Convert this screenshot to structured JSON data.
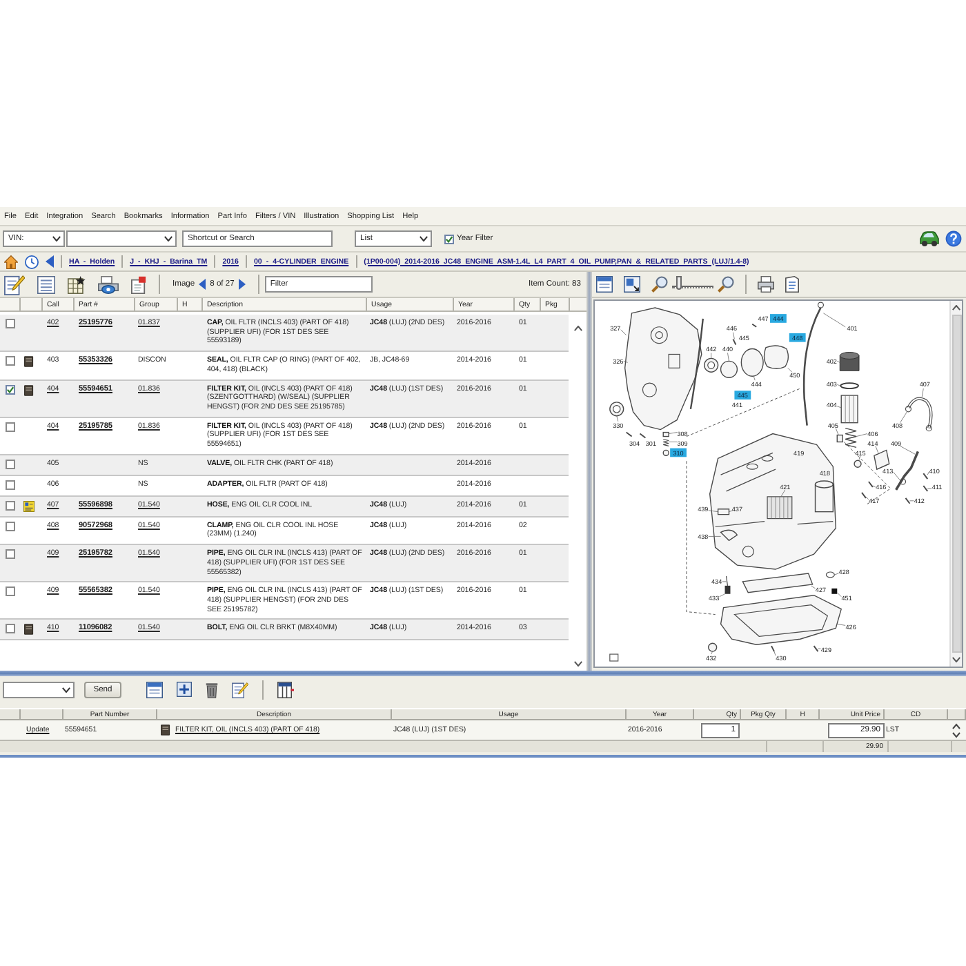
{
  "menu_bar": [
    "File",
    "Edit",
    "Integration",
    "Search",
    "Bookmarks",
    "Information",
    "Part Info",
    "Filters / VIN",
    "Illustration",
    "Shopping List",
    "Help"
  ],
  "toolbar": {
    "vin_select": "VIN:",
    "search_placeholder": "Shortcut or Search",
    "view_select": "List",
    "year_filter": {
      "label": "Year Filter",
      "checked": true
    }
  },
  "breadcrumb": [
    "HA - Holden",
    "J - KHJ - Barina TM",
    "2016",
    "00 - 4-CYLINDER ENGINE",
    "(1P00-004) 2014-2016 JC48 ENGINE ASM-1.4L L4 PART 4 OIL PUMP,PAN & RELATED PARTS (LUJ/1.4-8)"
  ],
  "parts_panel": {
    "image_label": "Image",
    "image_position": "8 of 27",
    "filter_placeholder": "Filter",
    "item_count": "Item Count: 83",
    "columns": [
      "Call",
      "Part #",
      "Group",
      "H",
      "Description",
      "Usage",
      "Year",
      "Qty",
      "Pkg"
    ],
    "rows": [
      {
        "kind": "plain",
        "checked": false,
        "linked": true,
        "call": "402",
        "part": "25195776",
        "group": "01.837",
        "description": "**CAP,** OIL FLTR (INCLS 403) (PART OF 418) (SUPPLIER UFI) (FOR 1ST DES SEE 55593189)",
        "usage": "**JC48** (LUJ) (2ND DES)",
        "year": "2016-2016",
        "qty": "01"
      },
      {
        "kind": "book",
        "checked": false,
        "linked": false,
        "call": "403",
        "part": "55353326",
        "group": "DISCON",
        "description": "**SEAL,** OIL FLTR CAP (O RING) (PART OF 402, 404, 418) (BLACK)",
        "usage": "JB, JC48-69",
        "year": "2014-2016",
        "qty": "01"
      },
      {
        "kind": "book",
        "checked": true,
        "linked": true,
        "call": "404",
        "part": "55594651",
        "group": "01.836",
        "description": "**FILTER KIT,** OIL (INCLS 403) (PART OF 418) (SZENTGOTTHARD) (W/SEAL) (SUPPLIER HENGST) (FOR 2ND DES SEE 25195785)",
        "usage": "**JC48** (LUJ) (1ST DES)",
        "year": "2016-2016",
        "qty": "01"
      },
      {
        "kind": "plain",
        "checked": false,
        "linked": true,
        "call": "404",
        "part": "25195785",
        "group": "01.836",
        "description": "**FILTER KIT,** OIL (INCLS 403) (PART OF 418) (SUPPLIER UFI) (FOR 1ST DES SEE 55594651)",
        "usage": "**JC48** (LUJ) (2ND DES)",
        "year": "2016-2016",
        "qty": "01"
      },
      {
        "kind": "plain",
        "checked": false,
        "linked": false,
        "call": "405",
        "group": "NS",
        "description": "**VALVE,** OIL FLTR CHK (PART OF 418)",
        "year": "2014-2016"
      },
      {
        "kind": "plain",
        "checked": false,
        "linked": false,
        "call": "406",
        "group": "NS",
        "description": "**ADAPTER,** OIL FLTR (PART OF 418)",
        "year": "2014-2016"
      },
      {
        "kind": "note",
        "checked": false,
        "linked": true,
        "call": "407",
        "part": "55596898",
        "group": "01.540",
        "description": "**HOSE,** ENG OIL CLR COOL INL",
        "usage": "**JC48** (LUJ)",
        "year": "2014-2016",
        "qty": "01"
      },
      {
        "kind": "plain",
        "checked": false,
        "linked": true,
        "call": "408",
        "part": "90572968",
        "group": "01.540",
        "description": "**CLAMP,** ENG OIL CLR COOL INL HOSE (23MM) (1.240)",
        "usage": "**JC48** (LUJ)",
        "year": "2014-2016",
        "qty": "02"
      },
      {
        "kind": "plain",
        "checked": false,
        "linked": true,
        "call": "409",
        "part": "25195782",
        "group": "01.540",
        "description": "**PIPE,** ENG OIL CLR INL (INCLS 413) (PART OF 418) (SUPPLIER UFI) (FOR 1ST DES SEE 55565382)",
        "usage": "**JC48** (LUJ) (2ND DES)",
        "year": "2016-2016",
        "qty": "01"
      },
      {
        "kind": "plain",
        "checked": false,
        "linked": true,
        "call": "409",
        "part": "55565382",
        "group": "01.540",
        "description": "**PIPE,** ENG OIL CLR INL (INCLS 413) (PART OF 418) (SUPPLIER HENGST) (FOR 2ND DES SEE 25195782)",
        "usage": "**JC48** (LUJ) (1ST DES)",
        "year": "2016-2016",
        "qty": "01"
      },
      {
        "kind": "book",
        "checked": false,
        "linked": true,
        "call": "410",
        "part": "11096082",
        "group": "01.540",
        "description": "**BOLT,** ENG OIL CLR BRKT (M8X40MM)",
        "usage": "**JC48** (LUJ)",
        "year": "2014-2016",
        "qty": "03"
      }
    ]
  },
  "illustration": {
    "zoom": {
      "level": 0.1
    },
    "callouts": [
      {
        "label": "447",
        "highlighted": false
      },
      {
        "label": "444",
        "highlighted": true
      },
      {
        "label": "327",
        "highlighted": false
      },
      {
        "label": "446",
        "highlighted": false
      },
      {
        "label": "401",
        "highlighted": false
      },
      {
        "label": "445",
        "highlighted": false
      },
      {
        "label": "448",
        "highlighted": true
      },
      {
        "label": "442",
        "highlighted": false
      },
      {
        "label": "440",
        "highlighted": false
      },
      {
        "label": "326",
        "highlighted": false
      },
      {
        "label": "402",
        "highlighted": false
      },
      {
        "label": "450",
        "highlighted": false
      },
      {
        "label": "444",
        "highlighted": false
      },
      {
        "label": "403",
        "highlighted": false
      },
      {
        "label": "407",
        "highlighted": false
      },
      {
        "label": "445",
        "highlighted": true
      },
      {
        "label": "441",
        "highlighted": false
      },
      {
        "label": "404",
        "highlighted": false
      },
      {
        "label": "330",
        "highlighted": false
      },
      {
        "label": "405",
        "highlighted": false
      },
      {
        "label": "408",
        "highlighted": false
      },
      {
        "label": "308",
        "highlighted": false
      },
      {
        "label": "406",
        "highlighted": false
      },
      {
        "label": "304",
        "highlighted": false
      },
      {
        "label": "301",
        "highlighted": false
      },
      {
        "label": "309",
        "highlighted": false
      },
      {
        "label": "414",
        "highlighted": false
      },
      {
        "label": "409",
        "highlighted": false
      },
      {
        "label": "310",
        "highlighted": true
      },
      {
        "label": "419",
        "highlighted": false
      },
      {
        "label": "415",
        "highlighted": false
      },
      {
        "label": "418",
        "highlighted": false
      },
      {
        "label": "413",
        "highlighted": false
      },
      {
        "label": "410",
        "highlighted": false
      },
      {
        "label": "421",
        "highlighted": false
      },
      {
        "label": "416",
        "highlighted": false
      },
      {
        "label": "411",
        "highlighted": false
      },
      {
        "label": "417",
        "highlighted": false
      },
      {
        "label": "412",
        "highlighted": false
      },
      {
        "label": "439",
        "highlighted": false
      },
      {
        "label": "437",
        "highlighted": false
      },
      {
        "label": "438",
        "highlighted": false
      },
      {
        "label": "428",
        "highlighted": false
      },
      {
        "label": "434",
        "highlighted": false
      },
      {
        "label": "427",
        "highlighted": false
      },
      {
        "label": "433",
        "highlighted": false
      },
      {
        "label": "451",
        "highlighted": false
      },
      {
        "label": "426",
        "highlighted": false
      },
      {
        "label": "429",
        "highlighted": false
      },
      {
        "label": "432",
        "highlighted": false
      },
      {
        "label": "430",
        "highlighted": false
      }
    ]
  },
  "shopping_list": {
    "send_label": "Send",
    "columns": [
      "Part Number",
      "Description",
      "Usage",
      "Year",
      "Qty",
      "Pkg Qty",
      "H",
      "Unit Price",
      "CD"
    ],
    "rows": [
      {
        "kind": "book",
        "action": "Update",
        "part_number": "55594651",
        "description": "FILTER KIT, OIL (INCLS 403) (PART OF 418)",
        "usage": "JC48 (LUJ) (1ST DES)",
        "year": "2016-2016",
        "qty": "1",
        "unit_price": "29.90",
        "cd": "LST"
      }
    ],
    "total": "29.90"
  }
}
